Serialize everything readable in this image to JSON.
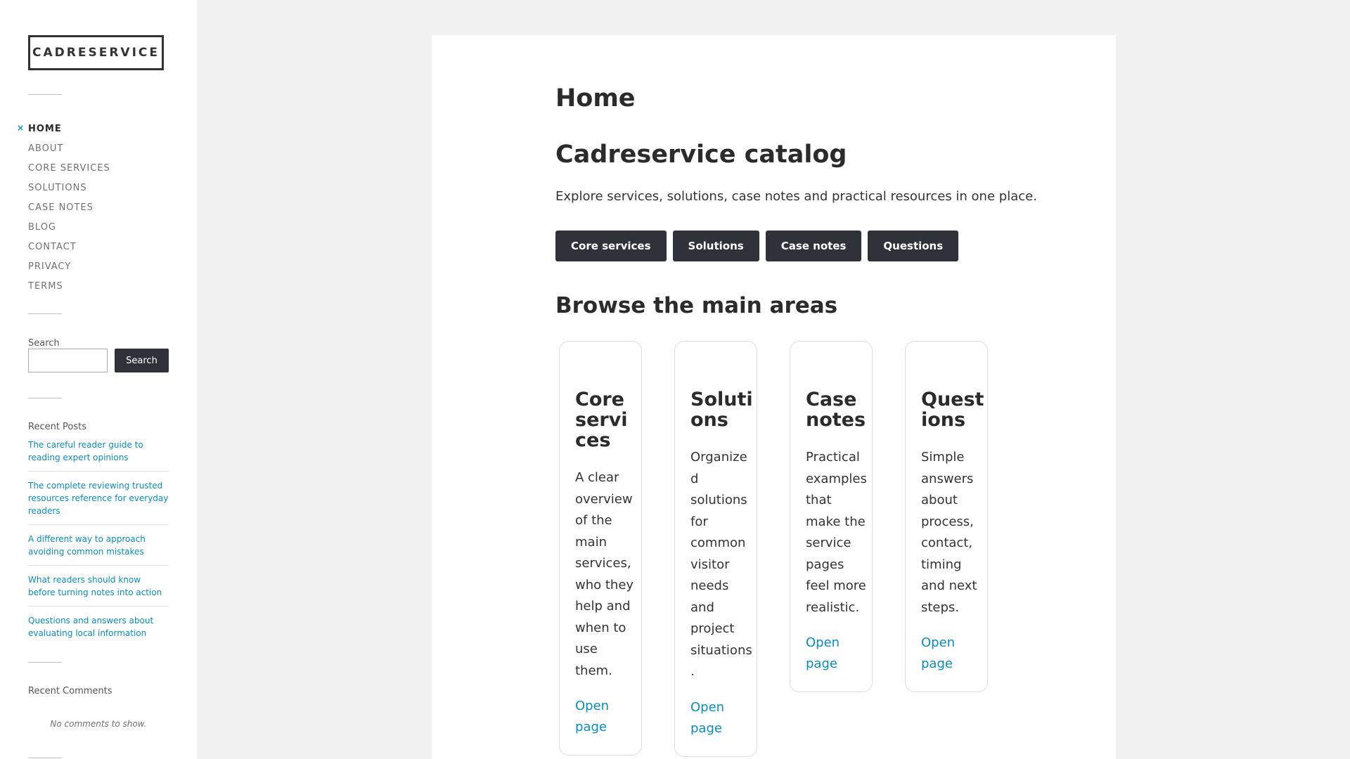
{
  "site": {
    "title": "CADRESERVICE"
  },
  "nav": {
    "current_marker": "×",
    "items": [
      "HOME",
      "ABOUT",
      "CORE SERVICES",
      "SOLUTIONS",
      "CASE NOTES",
      "BLOG",
      "CONTACT",
      "PRIVACY",
      "TERMS"
    ]
  },
  "search": {
    "label": "Search",
    "button_label": "Search",
    "value": "",
    "placeholder": ""
  },
  "recent_posts": {
    "title": "Recent Posts",
    "items": [
      "The careful reader guide to reading expert opinions",
      "The complete reviewing trusted resources reference for everyday readers",
      "A different way to approach avoiding common mistakes",
      "What readers should know before turning notes into action",
      "Questions and answers about evaluating local information"
    ]
  },
  "recent_comments": {
    "title": "Recent Comments",
    "empty_text": "No comments to show."
  },
  "main": {
    "page_title": "Home",
    "heading": "Cadreservice catalog",
    "intro": "Explore services, solutions, case notes and practical resources in one place.",
    "buttons": [
      "Core services",
      "Solutions",
      "Case notes",
      "Questions"
    ],
    "areas_heading": "Browse the main areas",
    "cards": [
      {
        "title": "Core services",
        "description": "A clear overview of the main services, who they help and when to use them.",
        "link": "Open page"
      },
      {
        "title": "Solutions",
        "description": "Organized solutions for common visitor needs and project situations.",
        "link": "Open page"
      },
      {
        "title": "Case notes",
        "description": "Practical examples that make the service pages feel more realistic.",
        "link": "Open page"
      },
      {
        "title": "Questions",
        "description": "Simple answers about process, contact, timing and next steps.",
        "link": "Open page"
      }
    ]
  },
  "colors": {
    "accent": "#0e8ab8",
    "button_bg": "#2f3339",
    "page_bg": "#f1f1f1",
    "text": "#333333"
  }
}
